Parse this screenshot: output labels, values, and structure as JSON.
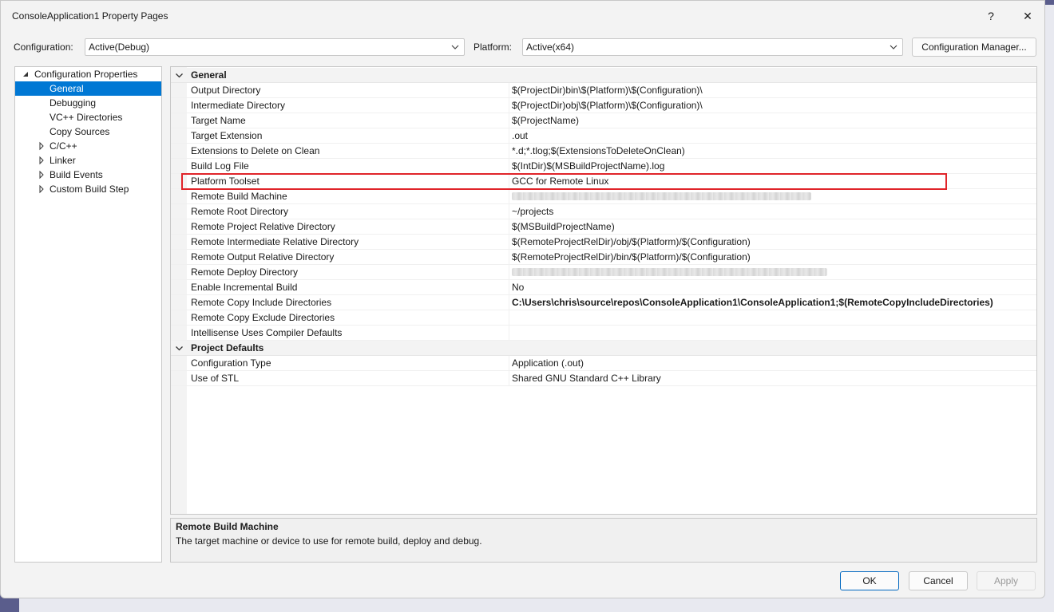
{
  "window": {
    "title": "ConsoleApplication1 Property Pages",
    "help_glyph": "?",
    "close_glyph": "✕"
  },
  "toolbar": {
    "configuration_label": "Configuration:",
    "configuration_value": "Active(Debug)",
    "platform_label": "Platform:",
    "platform_value": "Active(x64)",
    "config_manager_label": "Configuration Manager..."
  },
  "tree": {
    "root": "Configuration Properties",
    "items": [
      {
        "label": "General",
        "selected": true,
        "expandable": false
      },
      {
        "label": "Debugging",
        "selected": false,
        "expandable": false
      },
      {
        "label": "VC++ Directories",
        "selected": false,
        "expandable": false
      },
      {
        "label": "Copy Sources",
        "selected": false,
        "expandable": false
      },
      {
        "label": "C/C++",
        "selected": false,
        "expandable": true
      },
      {
        "label": "Linker",
        "selected": false,
        "expandable": true
      },
      {
        "label": "Build Events",
        "selected": false,
        "expandable": true
      },
      {
        "label": "Custom Build Step",
        "selected": false,
        "expandable": true
      }
    ]
  },
  "grid": {
    "categories": [
      {
        "name": "General",
        "rows": [
          {
            "name": "Output Directory",
            "value": "$(ProjectDir)bin\\$(Platform)\\$(Configuration)\\"
          },
          {
            "name": "Intermediate Directory",
            "value": "$(ProjectDir)obj\\$(Platform)\\$(Configuration)\\"
          },
          {
            "name": "Target Name",
            "value": "$(ProjectName)"
          },
          {
            "name": "Target Extension",
            "value": ".out"
          },
          {
            "name": "Extensions to Delete on Clean",
            "value": "*.d;*.tlog;$(ExtensionsToDeleteOnClean)"
          },
          {
            "name": "Build Log File",
            "value": "$(IntDir)$(MSBuildProjectName).log"
          },
          {
            "name": "Platform Toolset",
            "value": "GCC for Remote Linux"
          },
          {
            "name": "Remote Build Machine",
            "value": "",
            "blurred": true
          },
          {
            "name": "Remote Root Directory",
            "value": "~/projects"
          },
          {
            "name": "Remote Project Relative Directory",
            "value": "$(MSBuildProjectName)"
          },
          {
            "name": "Remote Intermediate Relative Directory",
            "value": "$(RemoteProjectRelDir)/obj/$(Platform)/$(Configuration)"
          },
          {
            "name": "Remote Output Relative Directory",
            "value": "$(RemoteProjectRelDir)/bin/$(Platform)/$(Configuration)"
          },
          {
            "name": "Remote Deploy Directory",
            "value": "",
            "blurred": true
          },
          {
            "name": "Enable Incremental Build",
            "value": "No"
          },
          {
            "name": "Remote Copy Include Directories",
            "value": "C:\\Users\\chris\\source\\repos\\ConsoleApplication1\\ConsoleApplication1;$(RemoteCopyIncludeDirectories)",
            "bold": true
          },
          {
            "name": "Remote Copy Exclude Directories",
            "value": ""
          },
          {
            "name": "Intellisense Uses Compiler Defaults",
            "value": ""
          }
        ]
      },
      {
        "name": "Project Defaults",
        "rows": [
          {
            "name": "Configuration Type",
            "value": "Application (.out)"
          },
          {
            "name": "Use of STL",
            "value": "Shared GNU Standard C++ Library"
          }
        ]
      }
    ]
  },
  "description": {
    "title": "Remote Build Machine",
    "text": "The target machine or device to use for remote build, deploy and debug."
  },
  "buttons": {
    "ok": "OK",
    "cancel": "Cancel",
    "apply": "Apply"
  },
  "colors": {
    "selection": "#0078d4",
    "highlight_border": "#e0242a",
    "background_accent": "#5a5d8c"
  }
}
